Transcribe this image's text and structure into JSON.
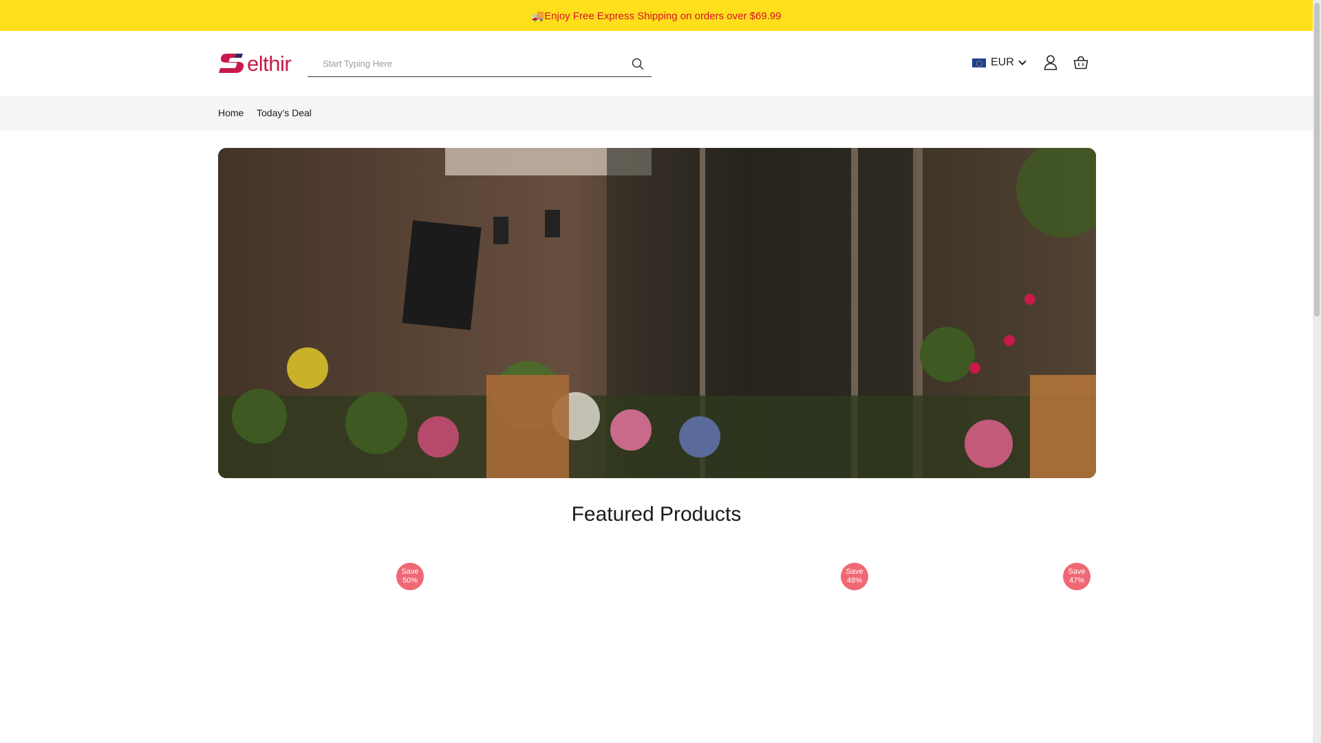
{
  "announcement": {
    "text": "🚚Enjoy Free Express Shipping on orders over $69.99"
  },
  "header": {
    "logo_text": "elthir",
    "search_placeholder": "Start Typing Here",
    "currency": "EUR"
  },
  "nav": {
    "items": [
      "Home",
      "Today’s Deal"
    ]
  },
  "hero": {
    "icon": "storefront-photo"
  },
  "featured": {
    "title": "Featured Products",
    "badges": [
      {
        "line1": "Save",
        "line2": "50%"
      },
      {
        "line1": "Save",
        "line2": "48%"
      },
      {
        "line1": "Save",
        "line2": "47%"
      }
    ]
  },
  "colors": {
    "announce_bg": "#fddf1b",
    "announce_text": "#d8112b",
    "brand": "#c8194a",
    "badge": "#ef6874",
    "nav_bg": "#f4f5f7"
  }
}
